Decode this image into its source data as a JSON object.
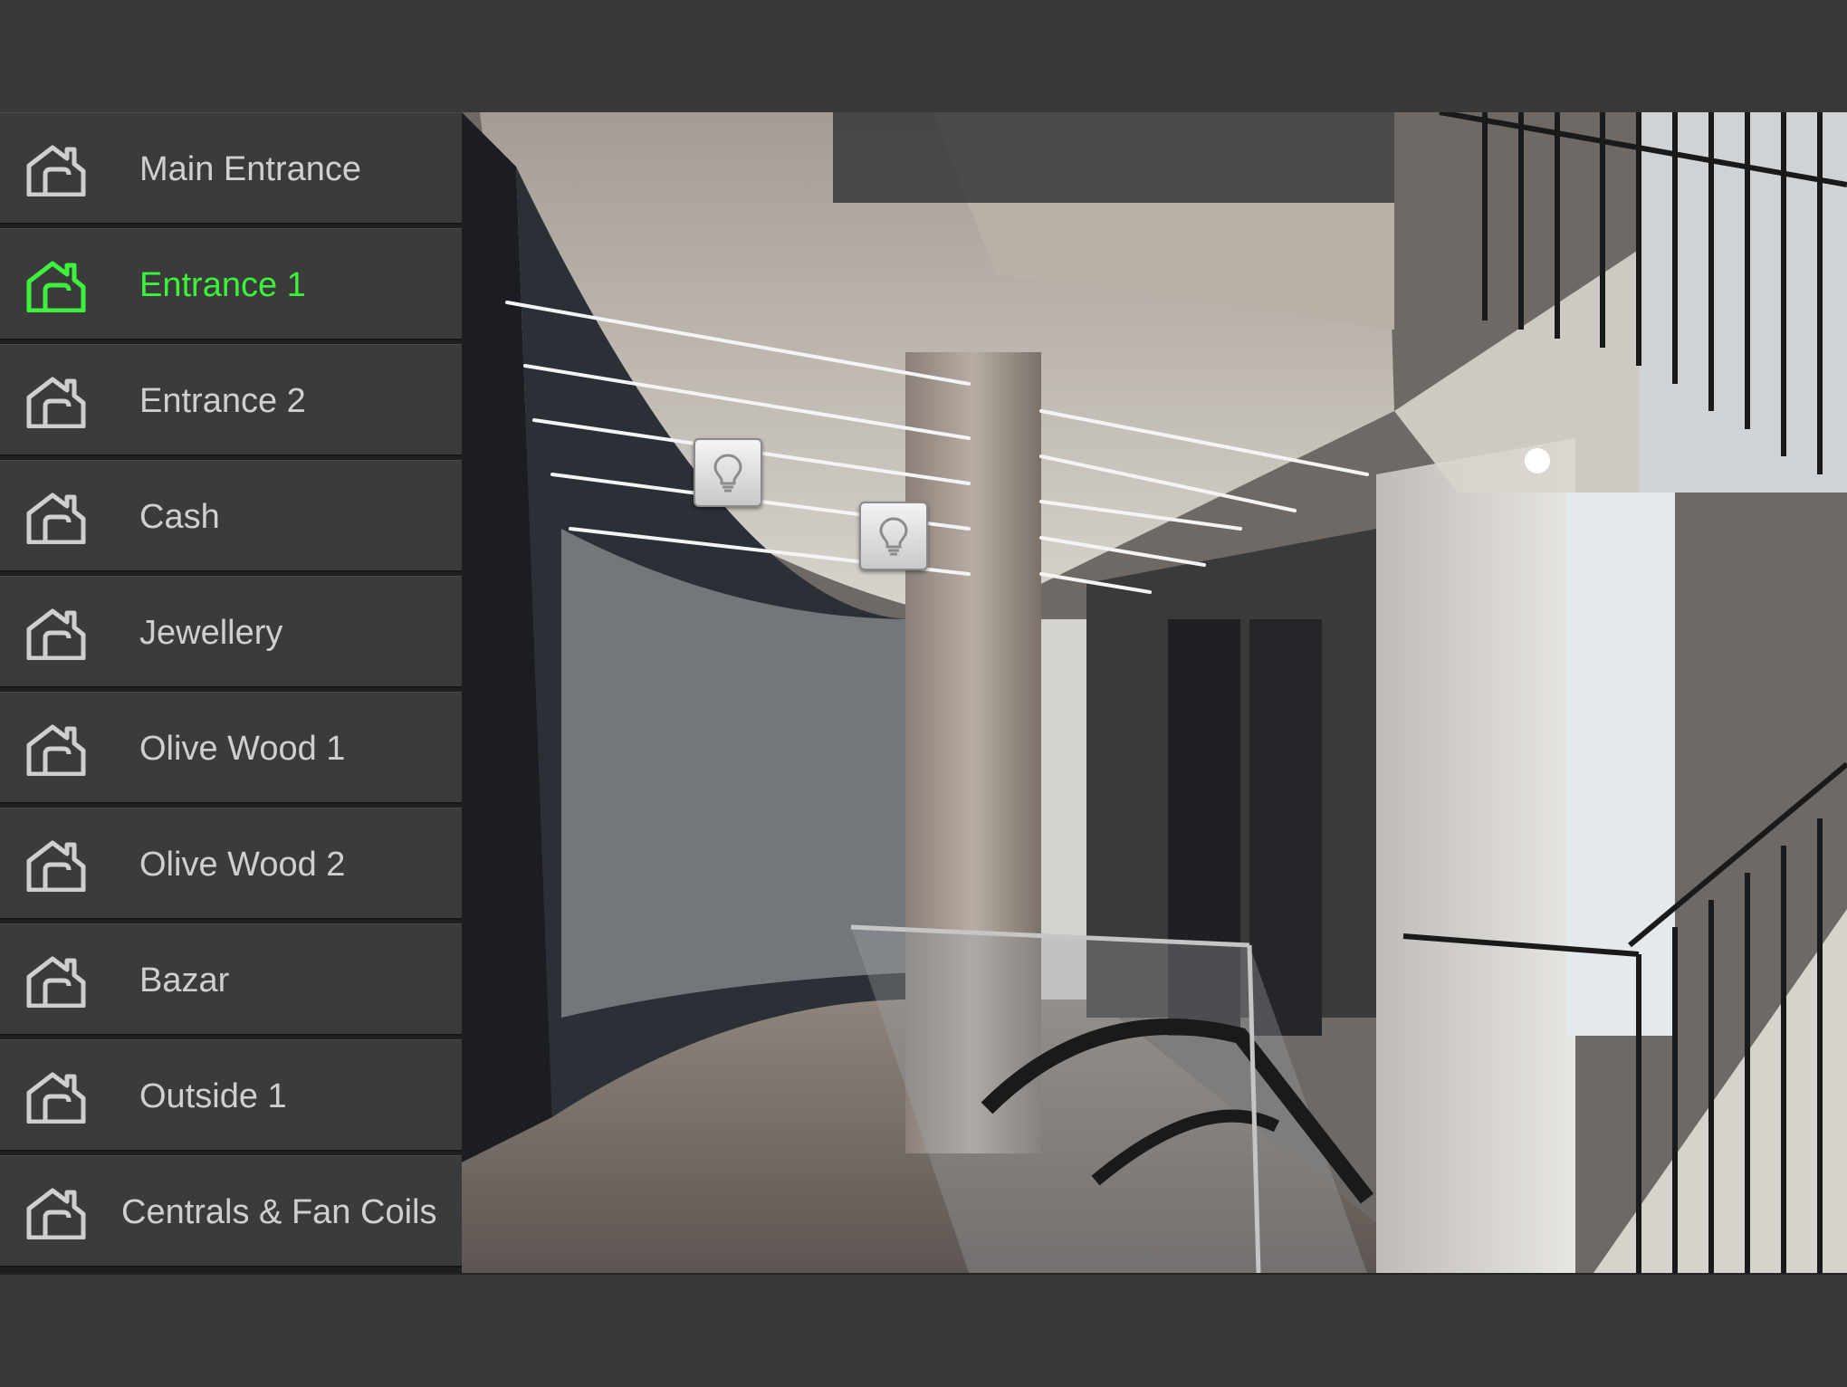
{
  "zones": [
    {
      "label": "Main Entrance",
      "icon": "home-icon",
      "active": false
    },
    {
      "label": "Entrance 1",
      "icon": "home-icon",
      "active": true
    },
    {
      "label": "Entrance 2",
      "icon": "home-icon",
      "active": false
    },
    {
      "label": "Cash",
      "icon": "home-icon",
      "active": false
    },
    {
      "label": "Jewellery",
      "icon": "home-icon",
      "active": false
    },
    {
      "label": "Olive Wood 1",
      "icon": "home-icon",
      "active": false
    },
    {
      "label": "Olive Wood 2",
      "icon": "home-icon",
      "active": false
    },
    {
      "label": "Bazar",
      "icon": "home-icon",
      "active": false
    },
    {
      "label": "Outside 1",
      "icon": "home-icon",
      "active": false
    },
    {
      "label": "Centrals & Fan Coils",
      "icon": "home-icon",
      "active": false
    }
  ],
  "light_controls": [
    {
      "icon": "lightbulb-icon"
    },
    {
      "icon": "lightbulb-icon"
    }
  ],
  "colors": {
    "active": "#3cf23c",
    "inactive_text": "#cfcfcf",
    "panel": "#3b3b3b"
  }
}
